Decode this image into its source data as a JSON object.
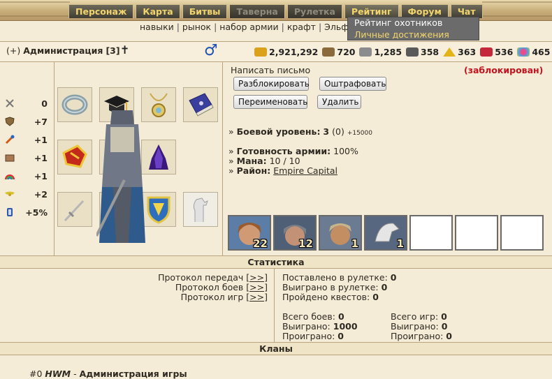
{
  "menu": [
    {
      "label": "Персонаж",
      "state": "normal"
    },
    {
      "label": "Карта",
      "state": "normal"
    },
    {
      "label": "Битвы",
      "state": "normal"
    },
    {
      "label": "Таверна",
      "state": "dim"
    },
    {
      "label": "Рулетка",
      "state": "dim"
    },
    {
      "label": "Рейтинг",
      "state": "active"
    },
    {
      "label": "Форум",
      "state": "normal"
    },
    {
      "label": "Чат",
      "state": "normal"
    }
  ],
  "submenu": [
    "навыки",
    "рынок",
    "набор армии",
    "крафт",
    "Эльф"
  ],
  "dropdown": [
    "Рейтинг охотников",
    "Личные достижения"
  ],
  "header": {
    "plus": "(+)",
    "name": "Администрация",
    "level": "[3]",
    "cross": "✝",
    "gender": "♂"
  },
  "resources": [
    {
      "icon": "gold-icon",
      "value": "2,921,292",
      "color": "#d9a21a"
    },
    {
      "icon": "wood-icon",
      "value": "720",
      "color": "#8a6a3b"
    },
    {
      "icon": "ore-icon",
      "value": "1,285",
      "color": "#8c8c8c"
    },
    {
      "icon": "mercury-icon",
      "value": "358",
      "color": "#6e6e6e"
    },
    {
      "icon": "sulfur-icon",
      "value": "363",
      "color": "#e2b419"
    },
    {
      "icon": "crystal-icon",
      "value": "536",
      "color": "#c4283a"
    },
    {
      "icon": "gems-icon",
      "value": "465",
      "color": "#c9a236"
    }
  ],
  "stats": [
    {
      "icon": "attack-icon",
      "value": "0"
    },
    {
      "icon": "defense-icon",
      "value": "+7"
    },
    {
      "icon": "spellpower-icon",
      "value": "+1"
    },
    {
      "icon": "knowledge-icon",
      "value": "+1"
    },
    {
      "icon": "luck-icon",
      "value": "+1"
    },
    {
      "icon": "morale-icon",
      "value": "+2"
    },
    {
      "icon": "initiative-icon",
      "value": "+5%"
    }
  ],
  "actions": {
    "write_letter": "Написать письмо",
    "blocked": "(заблокирован)",
    "unblock": "Разблокировать",
    "fine": "Оштрафовать",
    "rename": "Переименовать",
    "delete": "Удалить"
  },
  "info": {
    "combat_label": "Боевой уровень:",
    "combat_value": "3",
    "combat_exp": "(0)",
    "combat_next": "+15000",
    "army_label": "Готовность армии:",
    "army_value": "100%",
    "mana_label": "Мана:",
    "mana_value": "10 / 10",
    "district_label": "Район:",
    "district_value": "Empire Capital"
  },
  "army": [
    {
      "icon": "archer-unit-icon",
      "count": "22",
      "color": "#a0643c"
    },
    {
      "icon": "footman-unit-icon",
      "count": "12",
      "color": "#7a7a6a"
    },
    {
      "icon": "priest-unit-icon",
      "count": "1",
      "color": "#b7873a"
    },
    {
      "icon": "griffin-unit-icon",
      "count": "1",
      "color": "#8d8d8d"
    },
    {
      "icon": "",
      "count": ""
    },
    {
      "icon": "",
      "count": ""
    },
    {
      "icon": "",
      "count": ""
    }
  ],
  "sections": {
    "statistics": "Статистика",
    "clans": "Кланы"
  },
  "protocols": [
    {
      "label": "Протокол передач",
      "link": "[>>]"
    },
    {
      "label": "Протокол боев",
      "link": "[>>]"
    },
    {
      "label": "Протокол игр",
      "link": "[>>]"
    }
  ],
  "roulette": [
    {
      "label": "Поставлено в рулетке:",
      "value": "0"
    },
    {
      "label": "Выиграно в рулетке:",
      "value": "0"
    },
    {
      "label": "Пройдено квестов:",
      "value": "0"
    }
  ],
  "battles": [
    {
      "label": "Всего боев:",
      "value": "0"
    },
    {
      "label": "Выиграно:",
      "value": "1000"
    },
    {
      "label": "Проиграно:",
      "value": "0"
    }
  ],
  "games": [
    {
      "label": "Всего игр:",
      "value": "0"
    },
    {
      "label": "Выиграно:",
      "value": "0"
    },
    {
      "label": "Проиграно:",
      "value": "0"
    }
  ],
  "clan": {
    "id": "#0",
    "tag": "HWM",
    "dash": " - ",
    "name": "Администрация игры"
  }
}
